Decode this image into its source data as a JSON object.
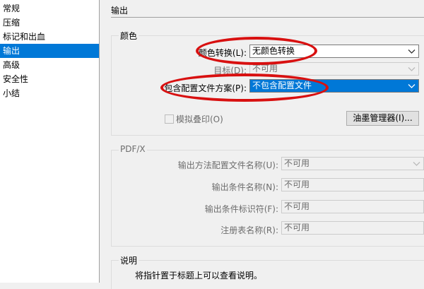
{
  "sidebar": {
    "items": [
      {
        "label": "常规"
      },
      {
        "label": "压缩"
      },
      {
        "label": "标记和出血"
      },
      {
        "label": "输出"
      },
      {
        "label": "高级"
      },
      {
        "label": "安全性"
      },
      {
        "label": "小结"
      }
    ],
    "selected": "输出"
  },
  "main": {
    "section_title": "输出",
    "color_group": {
      "title": "颜色",
      "color_conversion": {
        "label": "颜色转换(L):",
        "value": "无颜色转换"
      },
      "destination": {
        "label": "目标(D):",
        "value": "不可用"
      },
      "profile_policy": {
        "label": "包含配置文件方案(P):",
        "value": "不包含配置文件"
      },
      "simulate_overprint": {
        "label": "模拟叠印(O)",
        "checked": false
      },
      "ink_manager_button": "油墨管理器(I)..."
    },
    "pdfx_group": {
      "title": "PDF/X",
      "output_intent_profile": {
        "label": "输出方法配置文件名称(U):",
        "value": "不可用"
      },
      "output_condition_name": {
        "label": "输出条件名称(N):",
        "value": "不可用"
      },
      "output_condition_identifier": {
        "label": "输出条件标识符(F):",
        "value": "不可用"
      },
      "registry_name": {
        "label": "注册表名称(R):",
        "value": "不可用"
      }
    },
    "description": {
      "title": "说明",
      "text": "将指针置于标题上可以查看说明。"
    }
  },
  "annotations": {
    "highlight_color": "#d81010"
  }
}
